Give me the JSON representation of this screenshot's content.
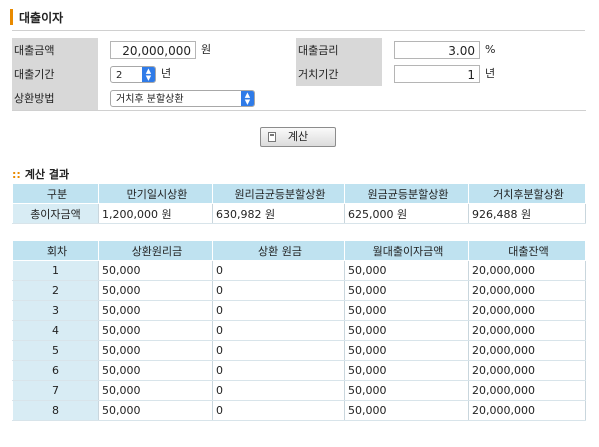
{
  "title": "대출이자",
  "form": {
    "amount_label": "대출금액",
    "amount_value": "20,000,000",
    "amount_unit": "원",
    "rate_label": "대출금리",
    "rate_value": "3.00",
    "rate_unit": "%",
    "period_label": "대출기간",
    "period_value": "2",
    "period_unit": "년",
    "grace_label": "거치기간",
    "grace_value": "1",
    "grace_unit": "년",
    "method_label": "상환방법",
    "method_value": "거치후 분할상환"
  },
  "calc_button": "계산",
  "result": {
    "title": "계산 결과",
    "dots": "::",
    "summary_headers": [
      "구분",
      "만기일시상환",
      "원리금균등분할상환",
      "원금균등분할상환",
      "거치후분할상환"
    ],
    "summary_row": [
      "총이자금액",
      "1,200,000 원",
      "630,982 원",
      "625,000 원",
      "926,488 원"
    ],
    "schedule_headers": [
      "회차",
      "상환원리금",
      "상환 원금",
      "월대출이자금액",
      "대출잔액"
    ],
    "schedule_rows": [
      [
        "1",
        "50,000",
        "0",
        "50,000",
        "20,000,000"
      ],
      [
        "2",
        "50,000",
        "0",
        "50,000",
        "20,000,000"
      ],
      [
        "3",
        "50,000",
        "0",
        "50,000",
        "20,000,000"
      ],
      [
        "4",
        "50,000",
        "0",
        "50,000",
        "20,000,000"
      ],
      [
        "5",
        "50,000",
        "0",
        "50,000",
        "20,000,000"
      ],
      [
        "6",
        "50,000",
        "0",
        "50,000",
        "20,000,000"
      ],
      [
        "7",
        "50,000",
        "0",
        "50,000",
        "20,000,000"
      ],
      [
        "8",
        "50,000",
        "0",
        "50,000",
        "20,000,000"
      ]
    ]
  },
  "colors": {
    "accent": "#e98a00",
    "header_bg": "#bfe2f0",
    "label_bg": "#d8d8d8",
    "select_arrow": "#2f7be8"
  }
}
